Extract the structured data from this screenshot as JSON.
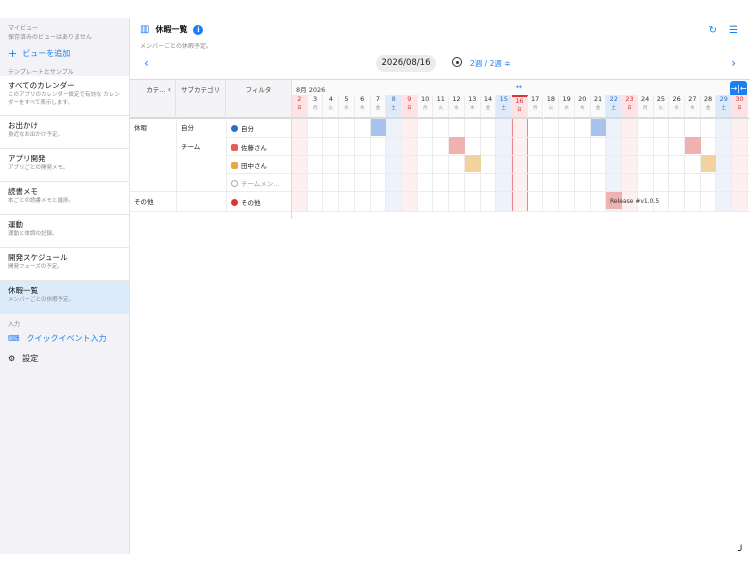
{
  "sidebar": {
    "my_view_header": "マイビュー",
    "no_saved_views": "保存済みのビューはありません",
    "add_view_label": "ビューを追加",
    "templates_header": "テンプレートとサンプル",
    "items": [
      {
        "title": "すべてのカレンダー",
        "desc": "このアプリのカレンダー設定で有効な カレンダーをすべて表示します。"
      },
      {
        "title": "お出かけ",
        "desc": "身近なお出かけ予定。"
      },
      {
        "title": "アプリ開発",
        "desc": "アプリごとの開発メモ。"
      },
      {
        "title": "読書メモ",
        "desc": "本ごとの読書メモと進捗。"
      },
      {
        "title": "運動",
        "desc": "運動と体調の記録。"
      },
      {
        "title": "開発スケジュール",
        "desc": "開発フェーズの予定。"
      },
      {
        "title": "休暇一覧",
        "desc": "メンバーごとの休暇予定。"
      }
    ],
    "input_header": "入力",
    "quick_event_label": "クイックイベント入力",
    "settings_label": "設定"
  },
  "main": {
    "title": "休暇一覧",
    "subtitle": "メンバーごとの休暇予定。",
    "date": "2026/08/16",
    "range": "2週 / 2週 ≑",
    "month_label": "8月 2026"
  },
  "grid": {
    "col_category": "カテ…",
    "col_subcategory": "サブカテゴリ",
    "col_filter": "フィルタ",
    "rows": [
      {
        "category": "休暇",
        "subcategory": "自分",
        "filter": "自分"
      },
      {
        "category": "",
        "subcategory": "チーム",
        "filter": "佐藤さん"
      },
      {
        "category": "",
        "subcategory": "",
        "filter": "田中さん"
      },
      {
        "category": "",
        "subcategory": "",
        "filter": "チームメン…"
      },
      {
        "category": "その他",
        "subcategory": "",
        "filter": "その他"
      }
    ],
    "days": [
      {
        "d": "2",
        "w": "日"
      },
      {
        "d": "3",
        "w": "月"
      },
      {
        "d": "4",
        "w": "火"
      },
      {
        "d": "5",
        "w": "水"
      },
      {
        "d": "6",
        "w": "木"
      },
      {
        "d": "7",
        "w": "金"
      },
      {
        "d": "8",
        "w": "土"
      },
      {
        "d": "9",
        "w": "日"
      },
      {
        "d": "10",
        "w": "月"
      },
      {
        "d": "11",
        "w": "火"
      },
      {
        "d": "12",
        "w": "水"
      },
      {
        "d": "13",
        "w": "木"
      },
      {
        "d": "14",
        "w": "金"
      },
      {
        "d": "15",
        "w": "土"
      },
      {
        "d": "16",
        "w": "日"
      },
      {
        "d": "17",
        "w": "月"
      },
      {
        "d": "18",
        "w": "火"
      },
      {
        "d": "19",
        "w": "水"
      },
      {
        "d": "20",
        "w": "木"
      },
      {
        "d": "21",
        "w": "金"
      },
      {
        "d": "22",
        "w": "土"
      },
      {
        "d": "23",
        "w": "日"
      },
      {
        "d": "24",
        "w": "月"
      },
      {
        "d": "25",
        "w": "火"
      },
      {
        "d": "26",
        "w": "水"
      },
      {
        "d": "27",
        "w": "木"
      },
      {
        "d": "28",
        "w": "金"
      },
      {
        "d": "29",
        "w": "土"
      },
      {
        "d": "30",
        "w": "日"
      }
    ],
    "event_label": "Release #v1.0.5"
  }
}
